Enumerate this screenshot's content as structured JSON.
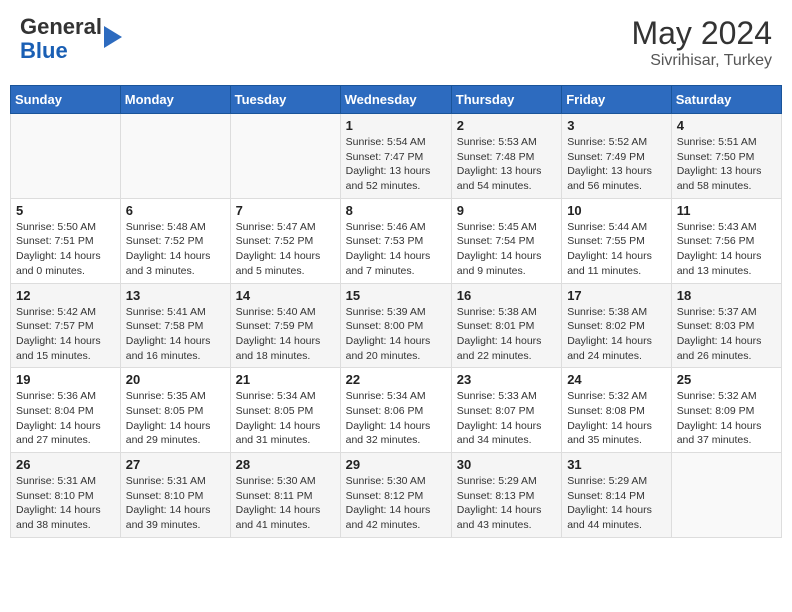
{
  "header": {
    "logo": {
      "general": "General",
      "blue": "Blue"
    },
    "month_year": "May 2024",
    "location": "Sivrihisar, Turkey"
  },
  "weekdays": [
    "Sunday",
    "Monday",
    "Tuesday",
    "Wednesday",
    "Thursday",
    "Friday",
    "Saturday"
  ],
  "weeks": [
    [
      {
        "day": "",
        "info": ""
      },
      {
        "day": "",
        "info": ""
      },
      {
        "day": "",
        "info": ""
      },
      {
        "day": "1",
        "info": "Sunrise: 5:54 AM\nSunset: 7:47 PM\nDaylight: 13 hours\nand 52 minutes."
      },
      {
        "day": "2",
        "info": "Sunrise: 5:53 AM\nSunset: 7:48 PM\nDaylight: 13 hours\nand 54 minutes."
      },
      {
        "day": "3",
        "info": "Sunrise: 5:52 AM\nSunset: 7:49 PM\nDaylight: 13 hours\nand 56 minutes."
      },
      {
        "day": "4",
        "info": "Sunrise: 5:51 AM\nSunset: 7:50 PM\nDaylight: 13 hours\nand 58 minutes."
      }
    ],
    [
      {
        "day": "5",
        "info": "Sunrise: 5:50 AM\nSunset: 7:51 PM\nDaylight: 14 hours\nand 0 minutes."
      },
      {
        "day": "6",
        "info": "Sunrise: 5:48 AM\nSunset: 7:52 PM\nDaylight: 14 hours\nand 3 minutes."
      },
      {
        "day": "7",
        "info": "Sunrise: 5:47 AM\nSunset: 7:52 PM\nDaylight: 14 hours\nand 5 minutes."
      },
      {
        "day": "8",
        "info": "Sunrise: 5:46 AM\nSunset: 7:53 PM\nDaylight: 14 hours\nand 7 minutes."
      },
      {
        "day": "9",
        "info": "Sunrise: 5:45 AM\nSunset: 7:54 PM\nDaylight: 14 hours\nand 9 minutes."
      },
      {
        "day": "10",
        "info": "Sunrise: 5:44 AM\nSunset: 7:55 PM\nDaylight: 14 hours\nand 11 minutes."
      },
      {
        "day": "11",
        "info": "Sunrise: 5:43 AM\nSunset: 7:56 PM\nDaylight: 14 hours\nand 13 minutes."
      }
    ],
    [
      {
        "day": "12",
        "info": "Sunrise: 5:42 AM\nSunset: 7:57 PM\nDaylight: 14 hours\nand 15 minutes."
      },
      {
        "day": "13",
        "info": "Sunrise: 5:41 AM\nSunset: 7:58 PM\nDaylight: 14 hours\nand 16 minutes."
      },
      {
        "day": "14",
        "info": "Sunrise: 5:40 AM\nSunset: 7:59 PM\nDaylight: 14 hours\nand 18 minutes."
      },
      {
        "day": "15",
        "info": "Sunrise: 5:39 AM\nSunset: 8:00 PM\nDaylight: 14 hours\nand 20 minutes."
      },
      {
        "day": "16",
        "info": "Sunrise: 5:38 AM\nSunset: 8:01 PM\nDaylight: 14 hours\nand 22 minutes."
      },
      {
        "day": "17",
        "info": "Sunrise: 5:38 AM\nSunset: 8:02 PM\nDaylight: 14 hours\nand 24 minutes."
      },
      {
        "day": "18",
        "info": "Sunrise: 5:37 AM\nSunset: 8:03 PM\nDaylight: 14 hours\nand 26 minutes."
      }
    ],
    [
      {
        "day": "19",
        "info": "Sunrise: 5:36 AM\nSunset: 8:04 PM\nDaylight: 14 hours\nand 27 minutes."
      },
      {
        "day": "20",
        "info": "Sunrise: 5:35 AM\nSunset: 8:05 PM\nDaylight: 14 hours\nand 29 minutes."
      },
      {
        "day": "21",
        "info": "Sunrise: 5:34 AM\nSunset: 8:05 PM\nDaylight: 14 hours\nand 31 minutes."
      },
      {
        "day": "22",
        "info": "Sunrise: 5:34 AM\nSunset: 8:06 PM\nDaylight: 14 hours\nand 32 minutes."
      },
      {
        "day": "23",
        "info": "Sunrise: 5:33 AM\nSunset: 8:07 PM\nDaylight: 14 hours\nand 34 minutes."
      },
      {
        "day": "24",
        "info": "Sunrise: 5:32 AM\nSunset: 8:08 PM\nDaylight: 14 hours\nand 35 minutes."
      },
      {
        "day": "25",
        "info": "Sunrise: 5:32 AM\nSunset: 8:09 PM\nDaylight: 14 hours\nand 37 minutes."
      }
    ],
    [
      {
        "day": "26",
        "info": "Sunrise: 5:31 AM\nSunset: 8:10 PM\nDaylight: 14 hours\nand 38 minutes."
      },
      {
        "day": "27",
        "info": "Sunrise: 5:31 AM\nSunset: 8:10 PM\nDaylight: 14 hours\nand 39 minutes."
      },
      {
        "day": "28",
        "info": "Sunrise: 5:30 AM\nSunset: 8:11 PM\nDaylight: 14 hours\nand 41 minutes."
      },
      {
        "day": "29",
        "info": "Sunrise: 5:30 AM\nSunset: 8:12 PM\nDaylight: 14 hours\nand 42 minutes."
      },
      {
        "day": "30",
        "info": "Sunrise: 5:29 AM\nSunset: 8:13 PM\nDaylight: 14 hours\nand 43 minutes."
      },
      {
        "day": "31",
        "info": "Sunrise: 5:29 AM\nSunset: 8:14 PM\nDaylight: 14 hours\nand 44 minutes."
      },
      {
        "day": "",
        "info": ""
      }
    ]
  ]
}
